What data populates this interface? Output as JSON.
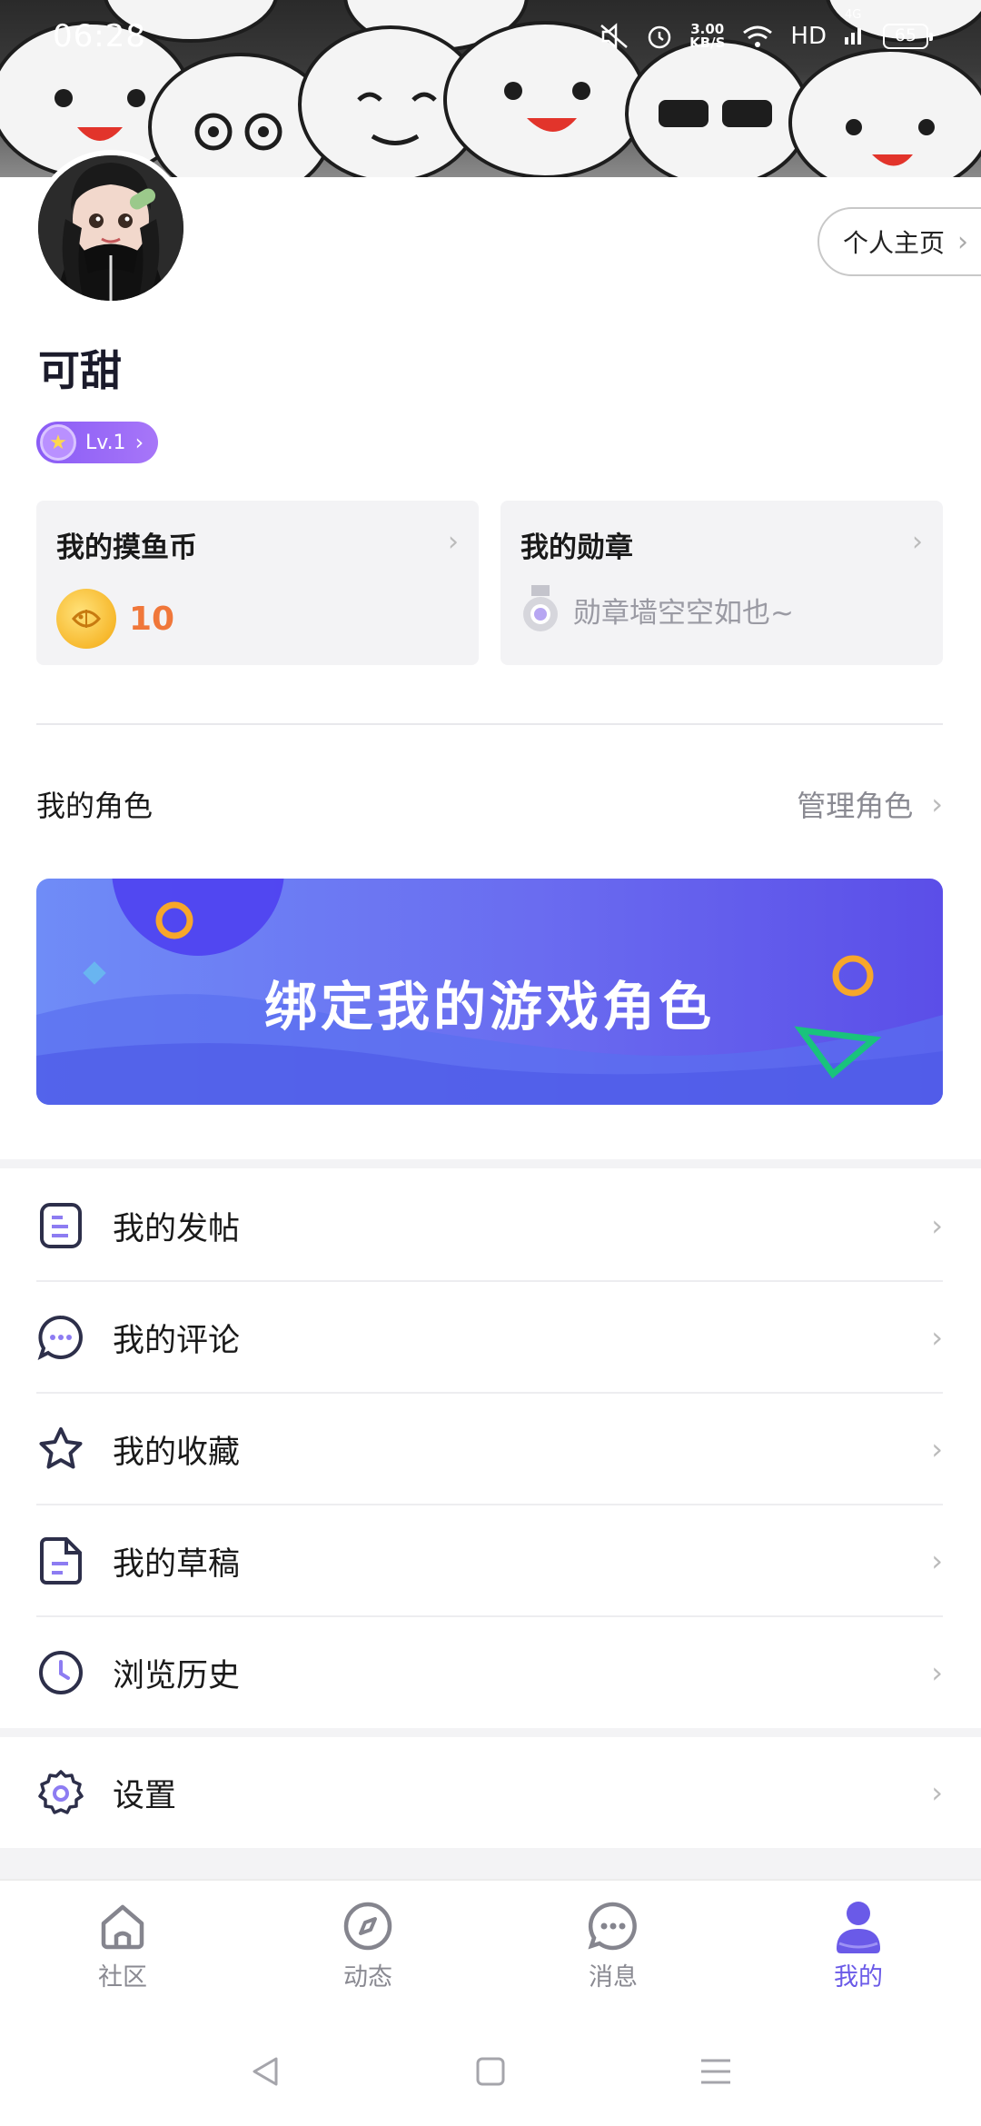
{
  "status_bar": {
    "time": "06:28",
    "speed_value": "3.00",
    "speed_unit": "KB/S",
    "network": "HD",
    "cell": "4G",
    "battery": "65"
  },
  "profile": {
    "username": "可甜",
    "level": "Lv.1",
    "home_button_label": "个人主页"
  },
  "cards": {
    "coins_title": "我的摸鱼币",
    "coins_count": "10",
    "medals_title": "我的勋章",
    "medals_empty_text": "勋章墙空空如也~"
  },
  "roles": {
    "title": "我的角色",
    "manage_label": "管理角色",
    "bind_banner_text": "绑定我的游戏角色"
  },
  "menu": {
    "items": [
      {
        "label": "我的发帖",
        "icon": "post-icon"
      },
      {
        "label": "我的评论",
        "icon": "comment-icon"
      },
      {
        "label": "我的收藏",
        "icon": "star-icon"
      },
      {
        "label": "我的草稿",
        "icon": "draft-icon"
      },
      {
        "label": "浏览历史",
        "icon": "clock-icon"
      }
    ],
    "settings_label": "设置"
  },
  "tabbar": {
    "tabs": [
      {
        "label": "社区",
        "icon": "home-icon"
      },
      {
        "label": "动态",
        "icon": "compass-icon"
      },
      {
        "label": "消息",
        "icon": "message-icon"
      },
      {
        "label": "我的",
        "icon": "user-icon",
        "active": true
      }
    ]
  },
  "colors": {
    "accent": "#6a5ae8",
    "coin_text": "#f0773a",
    "banner_start": "#6f8cf7",
    "banner_end": "#5b4ee8"
  }
}
